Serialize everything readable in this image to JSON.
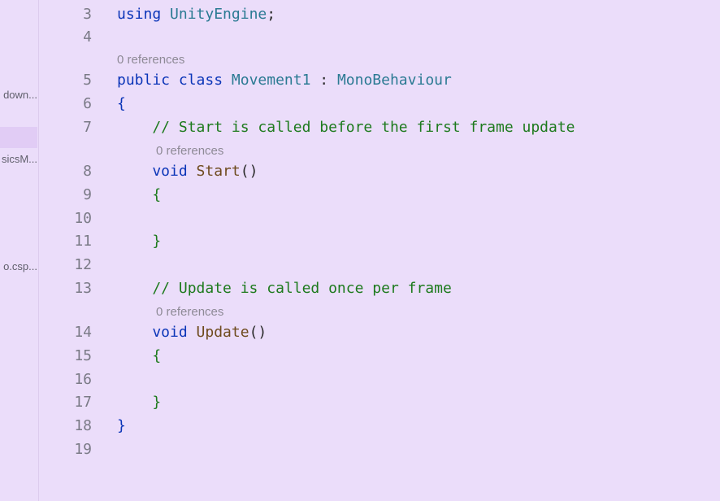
{
  "sidebar": {
    "items": [
      {
        "label": "down..."
      },
      {
        "label": ""
      },
      {
        "label": "sicsM..."
      },
      {
        "label": "o.csp..."
      }
    ]
  },
  "editor": {
    "codelens": "0 references",
    "lines": [
      {
        "n": "3",
        "tokens": [
          {
            "t": "using ",
            "c": "kw"
          },
          {
            "t": "UnityEngine",
            "c": "ty"
          },
          {
            "t": ";",
            "c": "pu"
          }
        ]
      },
      {
        "n": "4",
        "tokens": []
      },
      {
        "n": "5",
        "tokens": [
          {
            "t": "public ",
            "c": "kw"
          },
          {
            "t": "class ",
            "c": "kw"
          },
          {
            "t": "Movement1",
            "c": "ty"
          },
          {
            "t": " : ",
            "c": "pu"
          },
          {
            "t": "MonoBehaviour",
            "c": "ty"
          }
        ]
      },
      {
        "n": "6",
        "tokens": [
          {
            "t": "{",
            "c": "br"
          }
        ]
      },
      {
        "n": "7",
        "tokens": [
          {
            "t": "    // Start is called before the first frame update",
            "c": "cm"
          }
        ]
      },
      {
        "n": "8",
        "tokens": [
          {
            "t": "    void ",
            "c": "kw"
          },
          {
            "t": "Start",
            "c": "fn"
          },
          {
            "t": "()",
            "c": "pu"
          }
        ]
      },
      {
        "n": "9",
        "tokens": [
          {
            "t": "    {",
            "c": "br2"
          }
        ]
      },
      {
        "n": "10",
        "tokens": []
      },
      {
        "n": "11",
        "tokens": [
          {
            "t": "    }",
            "c": "br2"
          }
        ]
      },
      {
        "n": "12",
        "tokens": []
      },
      {
        "n": "13",
        "tokens": [
          {
            "t": "    // Update is called once per frame",
            "c": "cm"
          }
        ]
      },
      {
        "n": "14",
        "tokens": [
          {
            "t": "    void ",
            "c": "kw"
          },
          {
            "t": "Update",
            "c": "fn"
          },
          {
            "t": "()",
            "c": "pu"
          }
        ]
      },
      {
        "n": "15",
        "tokens": [
          {
            "t": "    {",
            "c": "br2"
          }
        ]
      },
      {
        "n": "16",
        "tokens": []
      },
      {
        "n": "17",
        "tokens": [
          {
            "t": "    }",
            "c": "br2"
          }
        ]
      },
      {
        "n": "18",
        "tokens": [
          {
            "t": "}",
            "c": "br"
          }
        ]
      },
      {
        "n": "19",
        "tokens": []
      }
    ]
  }
}
